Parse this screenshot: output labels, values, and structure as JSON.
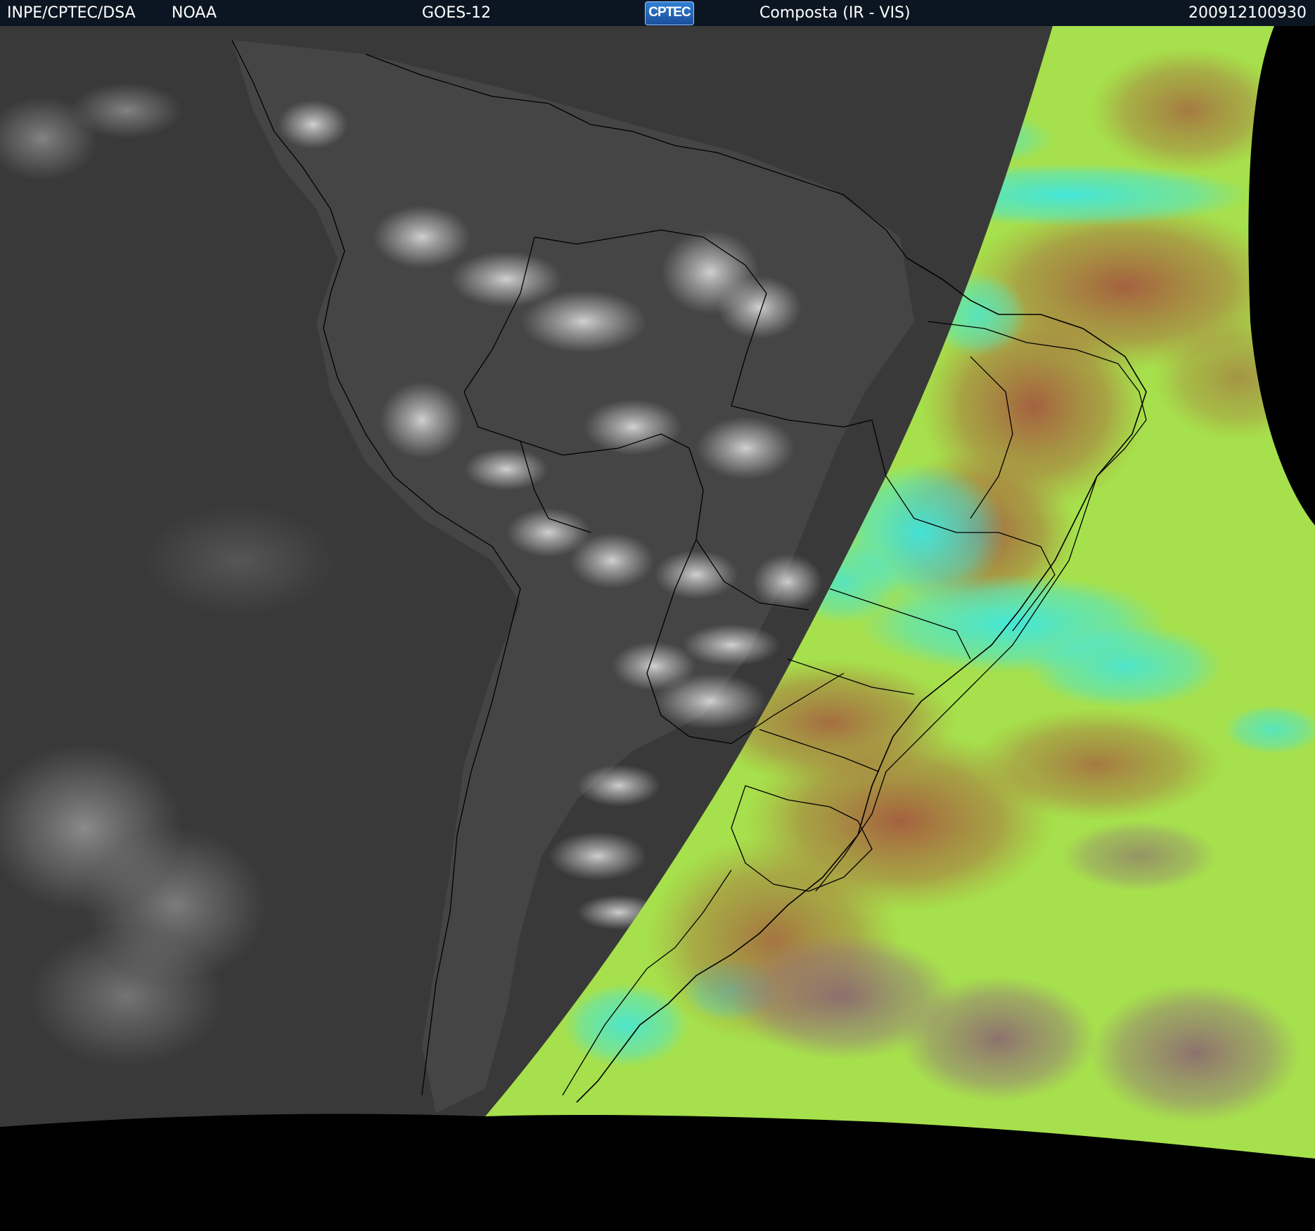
{
  "header": {
    "agency": "INPE/CPTEC/DSA",
    "provider": "NOAA",
    "satellite": "GOES-12",
    "logo_text": "CPTEC",
    "product": "Composta (IR - VIS)",
    "timestamp": "200912100930"
  },
  "colors": {
    "header_bg": "#0c1622",
    "ir_region": "#3a3a3a",
    "vis_green": "#a8e84a",
    "vis_cyan": "#3ee6e0",
    "vis_brown": "#a8613c",
    "space": "#000000",
    "boundaries": "#000000"
  }
}
